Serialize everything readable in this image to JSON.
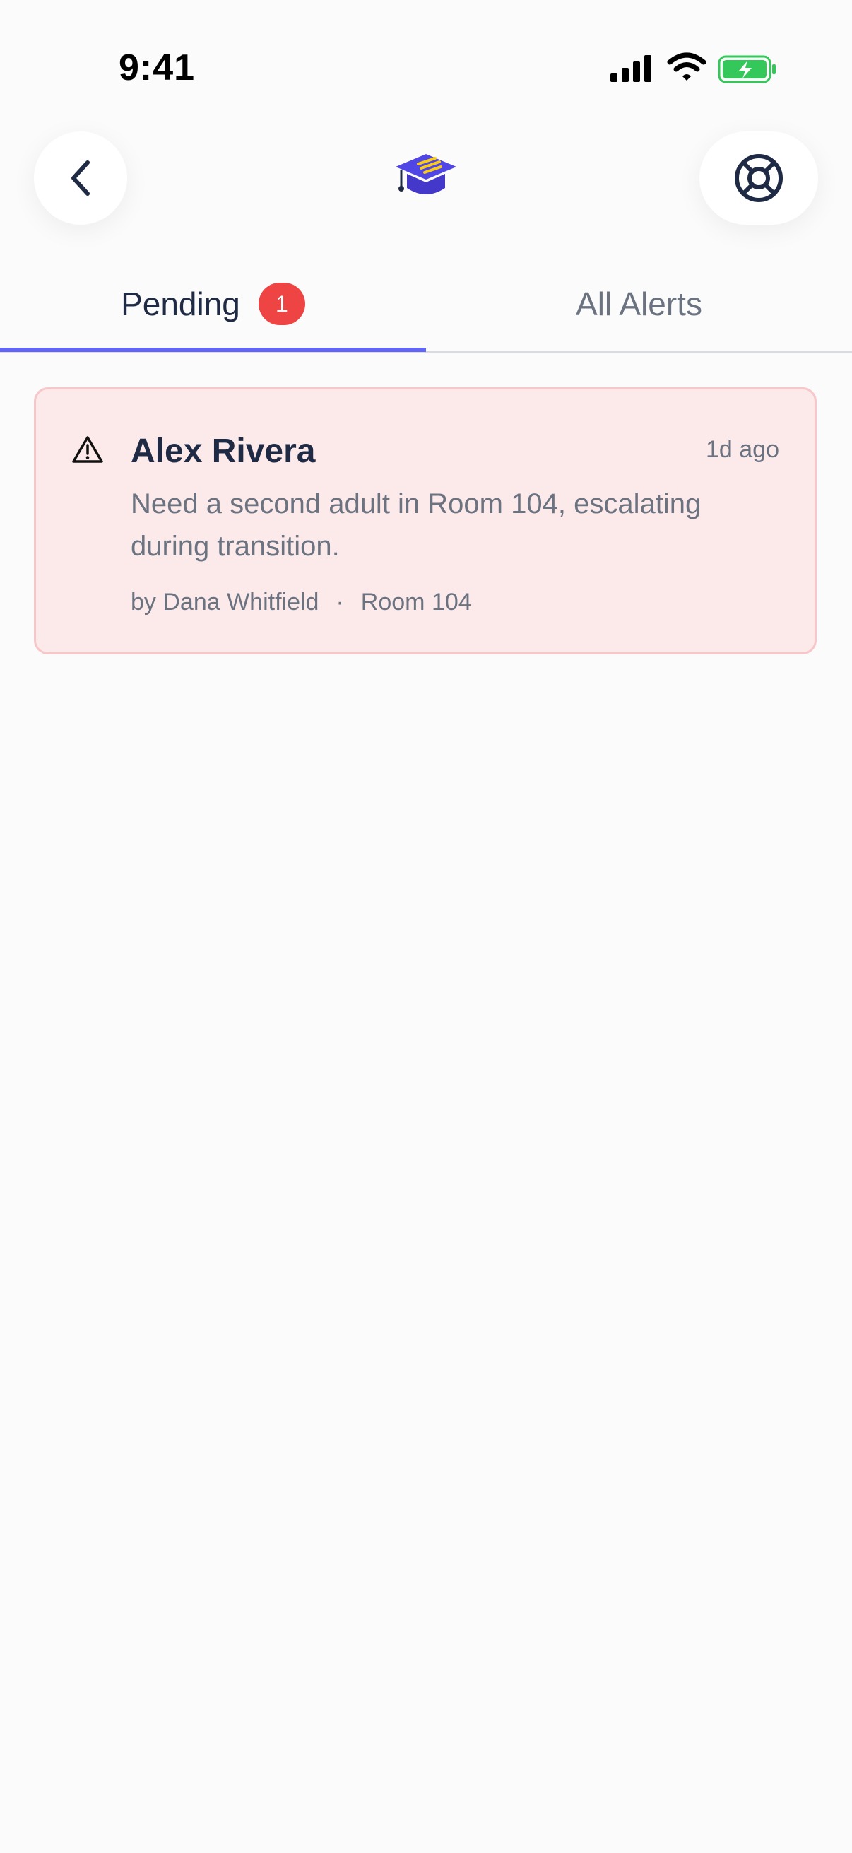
{
  "status_bar": {
    "time": "9:41",
    "icons": [
      "cellular-signal-icon",
      "wifi-icon",
      "battery-charging-icon"
    ]
  },
  "header": {
    "back_icon": "chevron-left-icon",
    "logo_icon": "graduation-cap-icon",
    "help_icon": "lifebuoy-icon"
  },
  "tabs": [
    {
      "label": "Pending",
      "badge": "1",
      "active": true
    },
    {
      "label": "All Alerts",
      "active": false
    }
  ],
  "alerts": [
    {
      "name": "Alex Rivera",
      "time": "1d ago",
      "message": "Need a second adult in Room 104, escalating during transition.",
      "author": "by Dana Whitfield",
      "separator": "·",
      "location": "Room 104",
      "icon": "warning-triangle-icon"
    }
  ],
  "colors": {
    "accent": "#6366f1",
    "badge": "#ef4444",
    "alert_bg": "#fce9ea",
    "alert_border": "#f6c6c9",
    "battery": "#34c759"
  }
}
